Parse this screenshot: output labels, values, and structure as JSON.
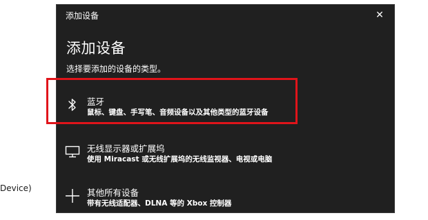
{
  "background": {
    "fragment_text": "Device)"
  },
  "dialog": {
    "window_title": "添加设备",
    "close_icon_glyph": "✕",
    "heading": "添加设备",
    "subtitle": "选择要添加的设备的类型。",
    "options": [
      {
        "icon": "bluetooth-icon",
        "name": "蓝牙",
        "description": "鼠标、键盘、手写笔、音频设备以及其他类型的蓝牙设备"
      },
      {
        "icon": "monitor-icon",
        "name": "无线显示器或扩展坞",
        "description": "使用 Miracast 或无线扩展坞的无线监视器、电视或电脑"
      },
      {
        "icon": "plus-icon",
        "name": "其他所有设备",
        "description": "带有无线适配器、DLNA 等的 Xbox 控制器"
      }
    ]
  },
  "colors": {
    "dialog_bg": "#202020",
    "highlight": "#e0141a",
    "text": "#ffffff"
  }
}
